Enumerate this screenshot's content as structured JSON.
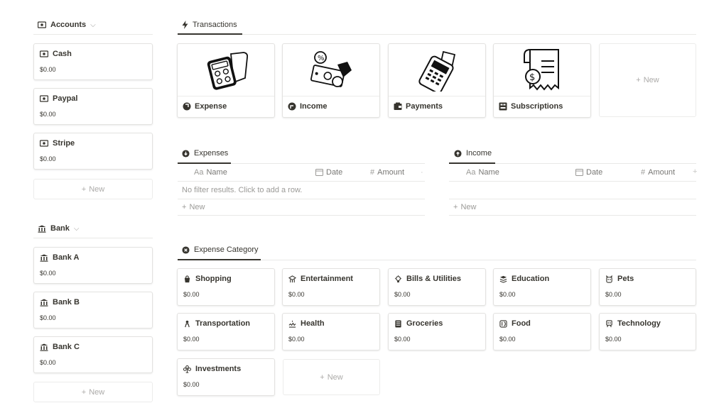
{
  "accounts": {
    "header": "Accounts",
    "chevron": "⌵",
    "items": [
      {
        "name": "Cash",
        "amount": "$0.00"
      },
      {
        "name": "Paypal",
        "amount": "$0.00"
      },
      {
        "name": "Stripe",
        "amount": "$0.00"
      }
    ],
    "new_label": "New"
  },
  "bank": {
    "header": "Bank",
    "chevron": "⌵",
    "items": [
      {
        "name": "Bank A",
        "amount": "$0.00"
      },
      {
        "name": "Bank B",
        "amount": "$0.00"
      },
      {
        "name": "Bank C",
        "amount": "$0.00"
      }
    ],
    "new_label": "New"
  },
  "transactions": {
    "tab": "Transactions",
    "items": [
      {
        "label": "Expense",
        "icon": "expense-icon"
      },
      {
        "label": "Income",
        "icon": "income-icon"
      },
      {
        "label": "Payments",
        "icon": "payments-icon"
      },
      {
        "label": "Subscriptions",
        "icon": "subscriptions-icon"
      }
    ],
    "new_label": "New"
  },
  "expenses": {
    "tab": "Expenses",
    "columns": {
      "name_prefix": "Aa",
      "name": "Name",
      "date": "Date",
      "amount_prefix": "#",
      "amount": "Amount"
    },
    "empty_text": "No filter results. Click to add a row.",
    "new_label": "New"
  },
  "income": {
    "tab": "Income",
    "columns": {
      "name_prefix": "Aa",
      "name": "Name",
      "date": "Date",
      "amount_prefix": "#",
      "amount": "Amount"
    },
    "new_label": "New"
  },
  "expense_category": {
    "tab": "Expense Category",
    "items": [
      {
        "name": "Shopping",
        "amount": "$0.00",
        "icon": "shopping-icon"
      },
      {
        "name": "Entertainment",
        "amount": "$0.00",
        "icon": "entertainment-icon"
      },
      {
        "name": "Bills & Utilities",
        "amount": "$0.00",
        "icon": "bills-icon"
      },
      {
        "name": "Education",
        "amount": "$0.00",
        "icon": "education-icon"
      },
      {
        "name": "Pets",
        "amount": "$0.00",
        "icon": "pets-icon"
      },
      {
        "name": "Transportation",
        "amount": "$0.00",
        "icon": "transportation-icon"
      },
      {
        "name": "Health",
        "amount": "$0.00",
        "icon": "health-icon"
      },
      {
        "name": "Groceries",
        "amount": "$0.00",
        "icon": "groceries-icon"
      },
      {
        "name": "Food",
        "amount": "$0.00",
        "icon": "food-icon"
      },
      {
        "name": "Technology",
        "amount": "$0.00",
        "icon": "technology-icon"
      },
      {
        "name": "Investments",
        "amount": "$0.00",
        "icon": "investments-icon"
      }
    ],
    "new_label": "New"
  },
  "common": {
    "plus": "+"
  }
}
